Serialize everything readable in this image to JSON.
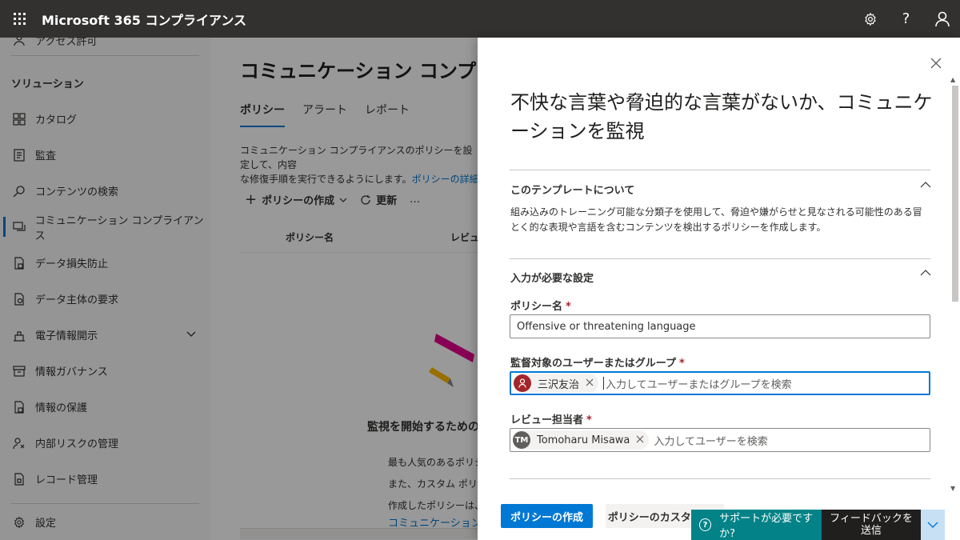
{
  "app": {
    "title": "Microsoft 365 コンプライアンス"
  },
  "topbar": {
    "icons": [
      "gear-icon",
      "help-icon",
      "person-icon"
    ],
    "help_glyph": "?"
  },
  "leftnav": {
    "top_item": "アクセス許可",
    "section_header": "ソリューション",
    "items": [
      {
        "label": "カタログ",
        "icon": "catalog-icon"
      },
      {
        "label": "監査",
        "icon": "audit-icon"
      },
      {
        "label": "コンテンツの検索",
        "icon": "search-icon"
      },
      {
        "label": "コミュニケーション コンプライアンス",
        "icon": "communication-icon",
        "active": true
      },
      {
        "label": "データ損失防止",
        "icon": "dlp-icon"
      },
      {
        "label": "データ主体の要求",
        "icon": "dsr-icon"
      },
      {
        "label": "電子情報開示",
        "icon": "ediscovery-icon",
        "expandable": true
      },
      {
        "label": "情報ガバナンス",
        "icon": "governance-icon"
      },
      {
        "label": "情報の保護",
        "icon": "protection-icon"
      },
      {
        "label": "内部リスクの管理",
        "icon": "insider-risk-icon"
      },
      {
        "label": "レコード管理",
        "icon": "records-icon"
      }
    ],
    "bottom_item": "設定"
  },
  "main": {
    "title": "コミュニケーション コンプライア",
    "tabs": [
      "ポリシー",
      "アラート",
      "レポート"
    ],
    "selected_tab": "ポリシー",
    "desc_line1": "コミュニケーション コンプライアンスのポリシーを設定して、内容",
    "desc_line2": "な修復手順を実行できるようにします。",
    "desc_link": "ポリシーの詳細",
    "cmd_create": "ポリシーの作成",
    "cmd_refresh": "更新",
    "cmd_more": "…",
    "col_policy_name": "ポリシー名",
    "col_review": "レビュー",
    "empty_title": "監視を開始するための選",
    "empty_line1": "最も人気のあるポリシ",
    "empty_line2": "また、カスタム ポリシー",
    "empty_line3": "作成したポリシーは、こ",
    "empty_link": "コミュニケーション コン"
  },
  "panel": {
    "title": "不快な言葉や脅迫的な言葉がないか、コミュニケーションを監視",
    "about_header": "このテンプレートについて",
    "about_body": "組み込みのトレーニング可能な分類子を使用して、脅迫や嫌がらせと見なされる可能性のある冒とく的な表現や言語を含むコンテンツを検出するポリシーを作成します。",
    "required_header": "入力が必要な設定",
    "policy_name_label": "ポリシー名",
    "policy_name_value": "Offensive or threatening language",
    "users_label": "監督対象のユーザーまたはグループ",
    "users_persona": "三沢友治",
    "users_placeholder": "入力してユーザーまたはグループを検索",
    "reviewers_label": "レビュー担当者",
    "reviewer_initials": "TM",
    "reviewer_name": "Tomoharu Misawa",
    "reviewers_placeholder": "入力してユーザーを検索",
    "required_mark": "*",
    "btn_create": "ポリシーの作成",
    "btn_customize": "ポリシーのカスタマイズ",
    "colors": {
      "accent": "#0078d4",
      "avatar_user": "#a4262c",
      "avatar_reviewer": "#605e5c"
    }
  },
  "helpbar": {
    "help_label": "サポートが必要ですか?",
    "help_glyph": "?",
    "feedback_label": "フィードバックを送信",
    "colors": {
      "help_bg": "#038387",
      "feedback_bg": "#201f1e"
    }
  }
}
